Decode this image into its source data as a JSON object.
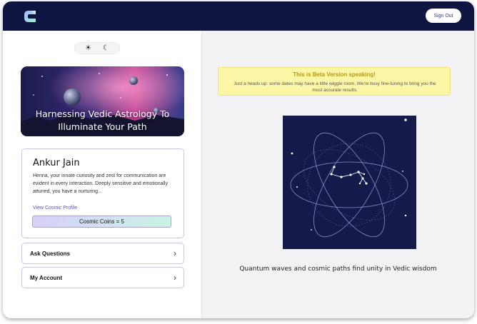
{
  "header": {
    "signout_label": "Sign Out",
    "logo_icon": "c-logo-icon"
  },
  "theme_toggle": {
    "light_icon": "sun-icon",
    "dark_icon": "moon-icon"
  },
  "banner": {
    "title_line1": "Harnessing Vedic Astrology To",
    "title_line2": "Illuminate Your Path"
  },
  "profile": {
    "name": "Ankur Jain",
    "description": "Henna, your innate curiosity and zest for communication are evident in every interaction. Deeply sensitive and emotionally attuned, you have a nurturing...",
    "link_label": "View Cosmic Profile",
    "coins_label": "Cosmic Coins = 5"
  },
  "menu": [
    {
      "label": "Ask Questions"
    },
    {
      "label": "My Account"
    }
  ],
  "beta": {
    "title": "This is Beta Version speaking!",
    "message": "Just a heads up: some dates may have a little wiggle room. We're busy fine-tuning to bring you the most accurate results."
  },
  "caption": "Quantum waves and cosmic paths find unity in Vedic wisdom",
  "colors": {
    "topbar": "#0f1440",
    "accent": "#5a4fc0",
    "beta_bg": "#fcf6a6",
    "beta_title": "#b09a16",
    "art_bg": "#141a4a"
  }
}
